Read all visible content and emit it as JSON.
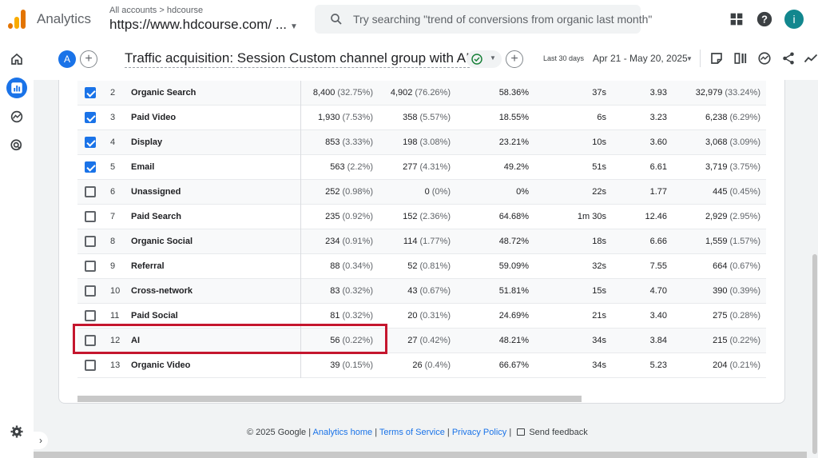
{
  "app": {
    "name": "Analytics"
  },
  "account": {
    "breadcrumb": "All accounts > hdcourse",
    "property": "https://www.hdcourse.com/ ..."
  },
  "search": {
    "placeholder": "Try searching \"trend of conversions from organic last month\""
  },
  "user": {
    "avatar_letter": "i"
  },
  "report": {
    "badge": "A",
    "title": "Traffic acquisition: Session Custom channel group with AI",
    "date_label": "Last 30 days",
    "date_range": "Apr 21 - May 20, 2025"
  },
  "colors": {
    "accent": "#1a73e8",
    "highlight": "#c5162e",
    "avatar": "#12878e"
  },
  "rows": [
    {
      "checked": true,
      "idx": "2",
      "channel": "Organic Search",
      "sessions": "8,400",
      "sessions_pct": "(32.75%)",
      "engaged": "4,902",
      "engaged_pct": "(76.26%)",
      "rate": "58.36%",
      "time": "37s",
      "events": "3.93",
      "ev_count": "32,979",
      "ev_pct": "(33.24%)"
    },
    {
      "checked": true,
      "idx": "3",
      "channel": "Paid Video",
      "sessions": "1,930",
      "sessions_pct": "(7.53%)",
      "engaged": "358",
      "engaged_pct": "(5.57%)",
      "rate": "18.55%",
      "time": "6s",
      "events": "3.23",
      "ev_count": "6,238",
      "ev_pct": "(6.29%)"
    },
    {
      "checked": true,
      "idx": "4",
      "channel": "Display",
      "sessions": "853",
      "sessions_pct": "(3.33%)",
      "engaged": "198",
      "engaged_pct": "(3.08%)",
      "rate": "23.21%",
      "time": "10s",
      "events": "3.60",
      "ev_count": "3,068",
      "ev_pct": "(3.09%)"
    },
    {
      "checked": true,
      "idx": "5",
      "channel": "Email",
      "sessions": "563",
      "sessions_pct": "(2.2%)",
      "engaged": "277",
      "engaged_pct": "(4.31%)",
      "rate": "49.2%",
      "time": "51s",
      "events": "6.61",
      "ev_count": "3,719",
      "ev_pct": "(3.75%)"
    },
    {
      "checked": false,
      "idx": "6",
      "channel": "Unassigned",
      "sessions": "252",
      "sessions_pct": "(0.98%)",
      "engaged": "0",
      "engaged_pct": "(0%)",
      "rate": "0%",
      "time": "22s",
      "events": "1.77",
      "ev_count": "445",
      "ev_pct": "(0.45%)"
    },
    {
      "checked": false,
      "idx": "7",
      "channel": "Paid Search",
      "sessions": "235",
      "sessions_pct": "(0.92%)",
      "engaged": "152",
      "engaged_pct": "(2.36%)",
      "rate": "64.68%",
      "time": "1m 30s",
      "events": "12.46",
      "ev_count": "2,929",
      "ev_pct": "(2.95%)"
    },
    {
      "checked": false,
      "idx": "8",
      "channel": "Organic Social",
      "sessions": "234",
      "sessions_pct": "(0.91%)",
      "engaged": "114",
      "engaged_pct": "(1.77%)",
      "rate": "48.72%",
      "time": "18s",
      "events": "6.66",
      "ev_count": "1,559",
      "ev_pct": "(1.57%)"
    },
    {
      "checked": false,
      "idx": "9",
      "channel": "Referral",
      "sessions": "88",
      "sessions_pct": "(0.34%)",
      "engaged": "52",
      "engaged_pct": "(0.81%)",
      "rate": "59.09%",
      "time": "32s",
      "events": "7.55",
      "ev_count": "664",
      "ev_pct": "(0.67%)"
    },
    {
      "checked": false,
      "idx": "10",
      "channel": "Cross-network",
      "sessions": "83",
      "sessions_pct": "(0.32%)",
      "engaged": "43",
      "engaged_pct": "(0.67%)",
      "rate": "51.81%",
      "time": "15s",
      "events": "4.70",
      "ev_count": "390",
      "ev_pct": "(0.39%)"
    },
    {
      "checked": false,
      "idx": "11",
      "channel": "Paid Social",
      "sessions": "81",
      "sessions_pct": "(0.32%)",
      "engaged": "20",
      "engaged_pct": "(0.31%)",
      "rate": "24.69%",
      "time": "21s",
      "events": "3.40",
      "ev_count": "275",
      "ev_pct": "(0.28%)"
    },
    {
      "checked": false,
      "idx": "12",
      "channel": "AI",
      "sessions": "56",
      "sessions_pct": "(0.22%)",
      "engaged": "27",
      "engaged_pct": "(0.42%)",
      "rate": "48.21%",
      "time": "34s",
      "events": "3.84",
      "ev_count": "215",
      "ev_pct": "(0.22%)"
    },
    {
      "checked": false,
      "idx": "13",
      "channel": "Organic Video",
      "sessions": "39",
      "sessions_pct": "(0.15%)",
      "engaged": "26",
      "engaged_pct": "(0.4%)",
      "rate": "66.67%",
      "time": "34s",
      "events": "5.23",
      "ev_count": "204",
      "ev_pct": "(0.21%)"
    }
  ],
  "footer": {
    "copyright": "© 2025 Google |",
    "analytics_home": "Analytics home",
    "sep1": "|",
    "terms": "Terms of Service",
    "sep2": "|",
    "privacy": "Privacy Policy",
    "sep3": "|",
    "feedback": "Send feedback"
  }
}
